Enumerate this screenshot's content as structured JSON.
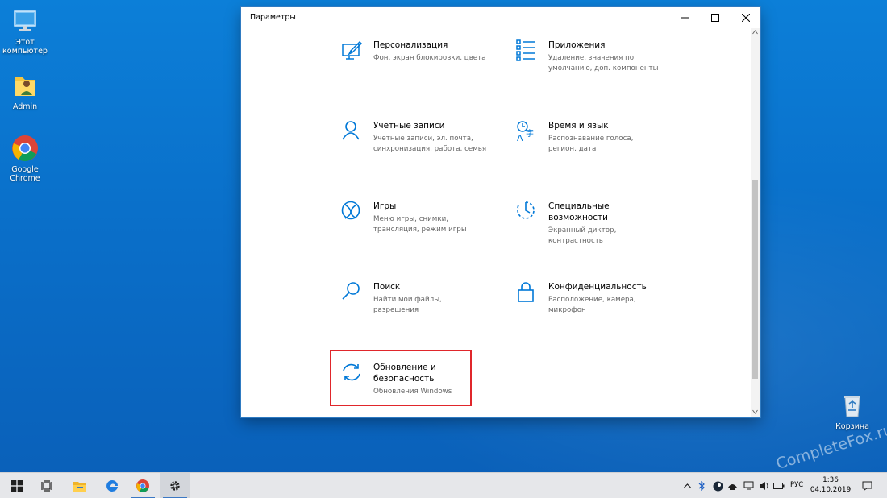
{
  "desktop": {
    "icons": [
      {
        "label": "Этот\nкомпьютер",
        "icon": "this-pc-icon"
      },
      {
        "label": "Admin",
        "icon": "user-folder-icon"
      },
      {
        "label": "Google\nChrome",
        "icon": "chrome-icon"
      },
      {
        "label": "Корзина",
        "icon": "recycle-bin-icon"
      }
    ]
  },
  "window": {
    "title": "Параметры",
    "controls": [
      "minimize-icon",
      "maximize-icon",
      "close-icon"
    ]
  },
  "settings": [
    {
      "title": "Персонализация",
      "desc": "Фон, экран блокировки, цвета",
      "icon": "personalization-icon"
    },
    {
      "title": "Приложения",
      "desc": "Удаление, значения по\nумолчанию, доп. компоненты",
      "icon": "apps-icon"
    },
    {
      "title": "Учетные записи",
      "desc": "Учетные записи, эл. почта,\nсинхронизация, работа, семья",
      "icon": "accounts-icon"
    },
    {
      "title": "Время и язык",
      "desc": "Распознавание голоса,\nрегион, дата",
      "icon": "time-language-icon"
    },
    {
      "title": "Игры",
      "desc": "Меню игры, снимки,\nтрансляция, режим игры",
      "icon": "xbox-icon"
    },
    {
      "title": "Специальные\nвозможности",
      "desc": "Экранный диктор,\nконтрастность",
      "icon": "ease-of-access-icon"
    },
    {
      "title": "Поиск",
      "desc": "Найти мои файлы,\nразрешения",
      "icon": "search-icon"
    },
    {
      "title": "Конфиденциальность",
      "desc": "Расположение, камера,\nмикрофон",
      "icon": "lock-icon"
    },
    {
      "title": "Обновление и\nбезопасность",
      "desc": "Обновления Windows",
      "icon": "update-icon"
    }
  ],
  "taskbar": {
    "buttons": [
      "windows-start-icon",
      "task-view-icon",
      "file-explorer-icon",
      "edge-icon",
      "chrome-icon",
      "settings-gear-icon"
    ],
    "lang": "РУС",
    "time": "1:36",
    "date": "04.10.2019"
  },
  "watermark": "CompleteFox.ru",
  "colors": {
    "accent": "#0078d7",
    "highlight": "#e0262b",
    "desktop": "#0a6fc9"
  }
}
